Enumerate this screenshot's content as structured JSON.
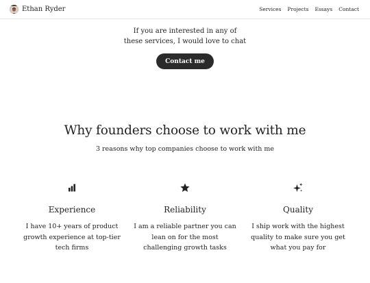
{
  "navbar": {
    "brand_name": "Ethan Ryder",
    "links": [
      "Services",
      "Projects",
      "Essays",
      "Contact"
    ]
  },
  "contact": {
    "line1": "If you are interested in any of",
    "line2": "these services, I would love to chat",
    "button_label": "Contact me"
  },
  "why": {
    "title": "Why founders choose to work with me",
    "subtitle": "3 reasons why top companies choose to work with me"
  },
  "features": [
    {
      "icon": "bar-chart-icon",
      "title": "Experience",
      "lines": [
        "I have 10+ years of product",
        "growth experience at top-tier",
        "tech firms"
      ]
    },
    {
      "icon": "star-icon",
      "title": "Reliability",
      "lines": [
        "I am a reliable partner you can",
        "lean on for the most",
        "challenging growth tasks"
      ]
    },
    {
      "icon": "sparkles-icon",
      "title": "Quality",
      "lines": [
        "I ship work with the highest",
        "quality to make sure you get",
        "what you pay for"
      ]
    }
  ],
  "colors": {
    "text": "#222222",
    "button_bg": "#2b2b2b",
    "button_text": "#ffffff",
    "divider": "#e6e6e6"
  }
}
